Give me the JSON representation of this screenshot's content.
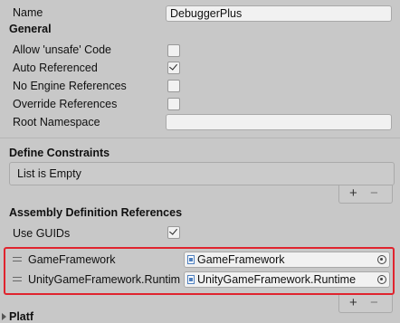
{
  "name_field": {
    "label": "Name",
    "value": "DebuggerPlus"
  },
  "general": {
    "title": "General",
    "allow_unsafe": {
      "label": "Allow 'unsafe' Code",
      "checked": false
    },
    "auto_referenced": {
      "label": "Auto Referenced",
      "checked": true
    },
    "no_engine_references": {
      "label": "No Engine References",
      "checked": false
    },
    "override_references": {
      "label": "Override References",
      "checked": false
    },
    "root_namespace": {
      "label": "Root Namespace",
      "value": ""
    }
  },
  "define_constraints": {
    "title": "Define Constraints",
    "empty_text": "List is Empty",
    "add": "+",
    "remove": "−"
  },
  "assembly_refs": {
    "title": "Assembly Definition References",
    "use_guids": {
      "label": "Use GUIDs",
      "checked": true
    },
    "items": [
      {
        "label": "GameFramework",
        "value": "GameFramework",
        "icon": "assembly-icon"
      },
      {
        "label": "UnityGameFramework.Runtim",
        "value": "UnityGameFramework.Runtime",
        "icon": "assembly-icon"
      }
    ],
    "add": "+",
    "remove": "−"
  },
  "next_section": {
    "title": "Platf"
  },
  "colors": {
    "highlight": "#e0242e",
    "background": "#c8c8c8"
  }
}
